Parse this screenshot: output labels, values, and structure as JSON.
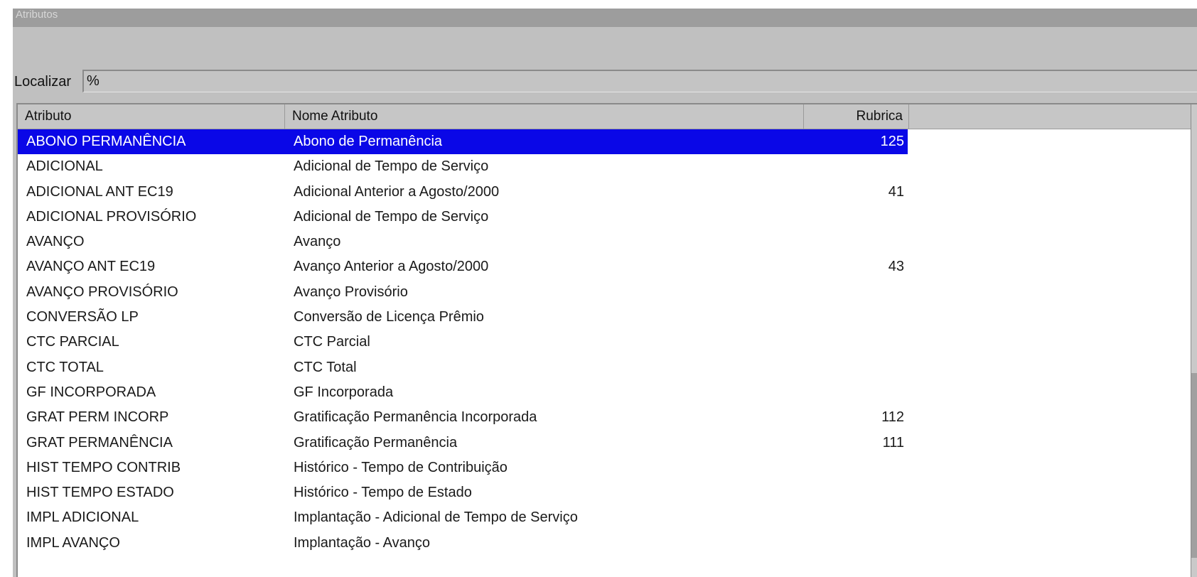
{
  "window": {
    "title": "Atributos"
  },
  "search": {
    "label": "Localizar",
    "value": "%"
  },
  "table": {
    "columns": [
      "Atributo",
      "Nome Atributo",
      "Rubrica"
    ],
    "rows": [
      {
        "atributo": "ABONO PERMANÊNCIA",
        "nome": "Abono de Permanência",
        "rubrica": "125",
        "selected": true
      },
      {
        "atributo": "ADICIONAL",
        "nome": "Adicional de Tempo de Serviço",
        "rubrica": ""
      },
      {
        "atributo": "ADICIONAL ANT EC19",
        "nome": "Adicional Anterior a Agosto/2000",
        "rubrica": "41"
      },
      {
        "atributo": "ADICIONAL PROVISÓRIO",
        "nome": "Adicional de Tempo de Serviço",
        "rubrica": ""
      },
      {
        "atributo": "AVANÇO",
        "nome": "Avanço",
        "rubrica": ""
      },
      {
        "atributo": "AVANÇO ANT EC19",
        "nome": "Avanço Anterior a Agosto/2000",
        "rubrica": "43"
      },
      {
        "atributo": "AVANÇO PROVISÓRIO",
        "nome": "Avanço Provisório",
        "rubrica": ""
      },
      {
        "atributo": "CONVERSÃO LP",
        "nome": "Conversão de Licença Prêmio",
        "rubrica": ""
      },
      {
        "atributo": "CTC PARCIAL",
        "nome": "CTC Parcial",
        "rubrica": ""
      },
      {
        "atributo": "CTC TOTAL",
        "nome": "CTC Total",
        "rubrica": ""
      },
      {
        "atributo": "GF INCORPORADA",
        "nome": "GF Incorporada",
        "rubrica": ""
      },
      {
        "atributo": "GRAT PERM INCORP",
        "nome": "Gratificação Permanência Incorporada",
        "rubrica": "112"
      },
      {
        "atributo": "GRAT PERMANÊNCIA",
        "nome": "Gratificação Permanência",
        "rubrica": "111"
      },
      {
        "atributo": "HIST TEMPO CONTRIB",
        "nome": "Histórico - Tempo de Contribuição",
        "rubrica": ""
      },
      {
        "atributo": "HIST TEMPO ESTADO",
        "nome": "Histórico - Tempo de Estado",
        "rubrica": ""
      },
      {
        "atributo": "IMPL ADICIONAL",
        "nome": "Implantação - Adicional de Tempo de Serviço",
        "rubrica": ""
      },
      {
        "atributo": "IMPL AVANÇO",
        "nome": "Implantação - Avanço",
        "rubrica": ""
      }
    ]
  },
  "colors": {
    "selection": "#0a07e7",
    "window_bg": "#c0c0c0",
    "titlebar": "#9d9d9d"
  }
}
